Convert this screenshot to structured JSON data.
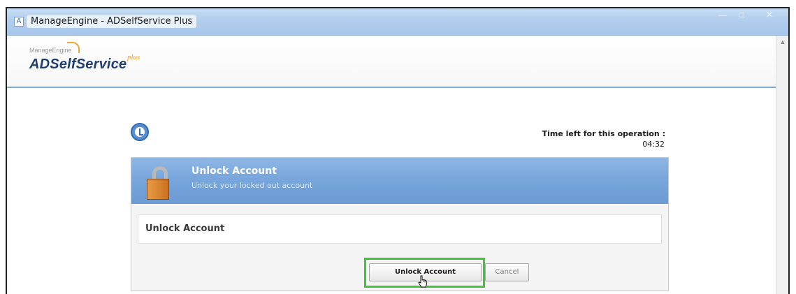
{
  "window": {
    "title": "ManageEngine - ADSelfService Plus"
  },
  "header": {
    "logo_small": "ManageEngine",
    "logo_main": "ADSelfService",
    "logo_plus": "plus"
  },
  "timer": {
    "label": "Time left for this operation :",
    "value": "04:32"
  },
  "panel": {
    "title": "Unlock Account",
    "subtitle": "Unlock your locked out account",
    "box_label": "Unlock Account"
  },
  "buttons": {
    "unlock_label": "Unlock Account",
    "cancel_label": "Cancel"
  },
  "colors": {
    "header_blue": "#78a6dc",
    "highlight_green": "#43c23a",
    "logo_navy": "#1f3f70",
    "logo_orange": "#f39c2d"
  },
  "icons": [
    "app-icon",
    "clock-icon",
    "lock-icon",
    "hand-cursor-icon"
  ]
}
